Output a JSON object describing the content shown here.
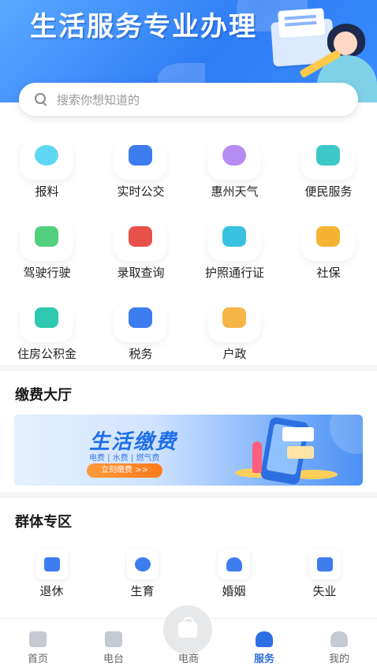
{
  "banner": {
    "title": "生活服务专业办理"
  },
  "search": {
    "placeholder": "搜索你想知道的"
  },
  "services": [
    {
      "label": "报料",
      "icon": "sun-icon",
      "color": "#5fd7f2"
    },
    {
      "label": "实时公交",
      "icon": "bus-icon",
      "color": "#3d7df0"
    },
    {
      "label": "惠州天气",
      "icon": "weather-cloud-icon",
      "color": "#b68cf2"
    },
    {
      "label": "便民服务",
      "icon": "heart-hands-icon",
      "color": "#3cc8c8"
    },
    {
      "label": "驾驶行驶",
      "icon": "license-card-icon",
      "color": "#52cf7d"
    },
    {
      "label": "录取查询",
      "icon": "graduation-cap-icon",
      "color": "#e8504a"
    },
    {
      "label": "护照通行证",
      "icon": "airplane-icon",
      "color": "#39c2e0"
    },
    {
      "label": "社保",
      "icon": "social-security-badge-icon",
      "color": "#f5b334"
    },
    {
      "label": "住房公积金",
      "icon": "house-fund-icon",
      "color": "#2fc8b0"
    },
    {
      "label": "税务",
      "icon": "tax-shield-icon",
      "color": "#3d7df0"
    },
    {
      "label": "户政",
      "icon": "household-registration-icon",
      "color": "#f7b548"
    }
  ],
  "payment_section": {
    "title": "缴费大厅",
    "banner_title": "生活缴费",
    "banner_subtitle": "电费 | 水费 | 燃气费",
    "banner_button": "立刻缴费 >>"
  },
  "group_section": {
    "title": "群体专区",
    "items": [
      {
        "label": "退休",
        "icon": "retiree-icon"
      },
      {
        "label": "生育",
        "icon": "baby-icon"
      },
      {
        "label": "婚姻",
        "icon": "marriage-heart-icon"
      },
      {
        "label": "失业",
        "icon": "unemployment-icon"
      }
    ]
  },
  "tabbar": {
    "items": [
      {
        "label": "首页",
        "icon": "home-icon",
        "active": false
      },
      {
        "label": "电台",
        "icon": "radio-icon",
        "active": false
      },
      {
        "label": "电商",
        "icon": "shopping-bag-icon",
        "active": false
      },
      {
        "label": "服务",
        "icon": "service-heart-icon",
        "active": true
      },
      {
        "label": "我的",
        "icon": "profile-icon",
        "active": false
      }
    ]
  },
  "colors": {
    "accent": "#2f6fe4",
    "banner": "#2f7df6"
  }
}
